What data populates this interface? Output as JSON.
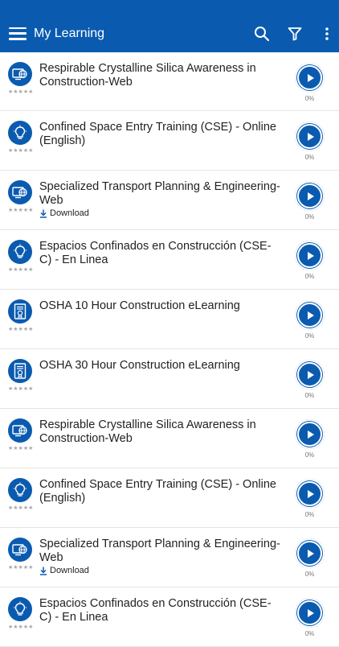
{
  "header": {
    "title": "My Learning",
    "menu_icon": "hamburger-menu-icon",
    "search_icon": "search-icon",
    "filter_icon": "filter-icon",
    "more_icon": "more-vertical-icon"
  },
  "colors": {
    "brand": "#0a5bb0"
  },
  "courses": [
    {
      "title": "Respirable Crystalline Silica Awareness in Construction-Web",
      "icon": "web-course-icon",
      "rating": "★★★★★",
      "progress": "0%",
      "download": ""
    },
    {
      "title": "Confined Space Entry Training (CSE) - Online (English)",
      "icon": "lightbulb-icon",
      "rating": "★★★★★",
      "progress": "0%",
      "download": ""
    },
    {
      "title": "Specialized Transport Planning & Engineering-Web",
      "icon": "web-course-icon",
      "rating": "★★★★★",
      "progress": "0%",
      "download": "Download"
    },
    {
      "title": "Espacios Confinados en Construcción (CSE-C) - En Linea",
      "icon": "lightbulb-icon",
      "rating": "★★★★★",
      "progress": "0%",
      "download": ""
    },
    {
      "title": "OSHA 10 Hour Construction eLearning",
      "icon": "certificate-icon",
      "rating": "★★★★★",
      "progress": "0%",
      "download": ""
    },
    {
      "title": "OSHA 30 Hour Construction eLearning",
      "icon": "certificate-icon",
      "rating": "★★★★★",
      "progress": "0%",
      "download": ""
    },
    {
      "title": "Respirable Crystalline Silica Awareness in Construction-Web",
      "icon": "web-course-icon",
      "rating": "★★★★★",
      "progress": "0%",
      "download": ""
    },
    {
      "title": "Confined Space Entry Training (CSE) - Online (English)",
      "icon": "lightbulb-icon",
      "rating": "★★★★★",
      "progress": "0%",
      "download": ""
    },
    {
      "title": "Specialized Transport Planning & Engineering-Web",
      "icon": "web-course-icon",
      "rating": "★★★★★",
      "progress": "0%",
      "download": "Download"
    },
    {
      "title": "Espacios Confinados en Construcción (CSE-C) - En Linea",
      "icon": "lightbulb-icon",
      "rating": "★★★★★",
      "progress": "0%",
      "download": ""
    }
  ]
}
